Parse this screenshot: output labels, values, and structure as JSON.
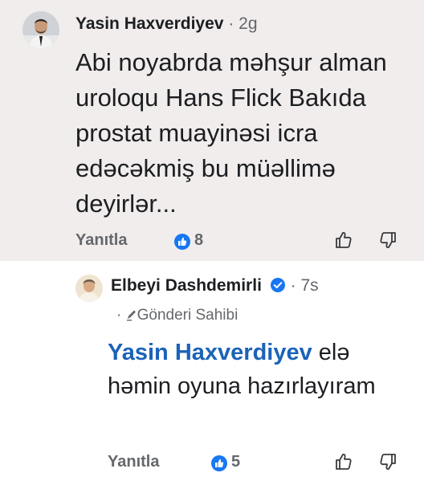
{
  "comment1": {
    "author": "Yasin Haxverdiyev",
    "separator": "·",
    "time": "2g",
    "text": "Abi noyabrda məhşur alman uroloqu Hans Flick Bakıda prostat muayinəsi icra edəcəkmiş bu müəllimə deyirlər...",
    "reply_label": "Yanıtla",
    "reaction_count": "8",
    "avatar_icon": "person-photo-avatar",
    "reaction_icon": "like-icon",
    "accent": "#1877f2",
    "background": "#f1eded"
  },
  "comment2": {
    "author": "Elbeyi Dashdemirli",
    "separator": "·",
    "time": "7s",
    "subtitle_prefix": "·",
    "subtitle": "Gönderi Sahibi",
    "mention": "Yasin Haxverdiyev",
    "text": " elə həmin oyuna hazırlayıram",
    "reply_label": "Yanıtla",
    "reaction_count": "5",
    "avatar_icon": "person-photo-avatar",
    "verified_icon": "verified-badge-icon",
    "author_badge_icon": "pencil-icon",
    "mention_color": "#1b63b8"
  }
}
